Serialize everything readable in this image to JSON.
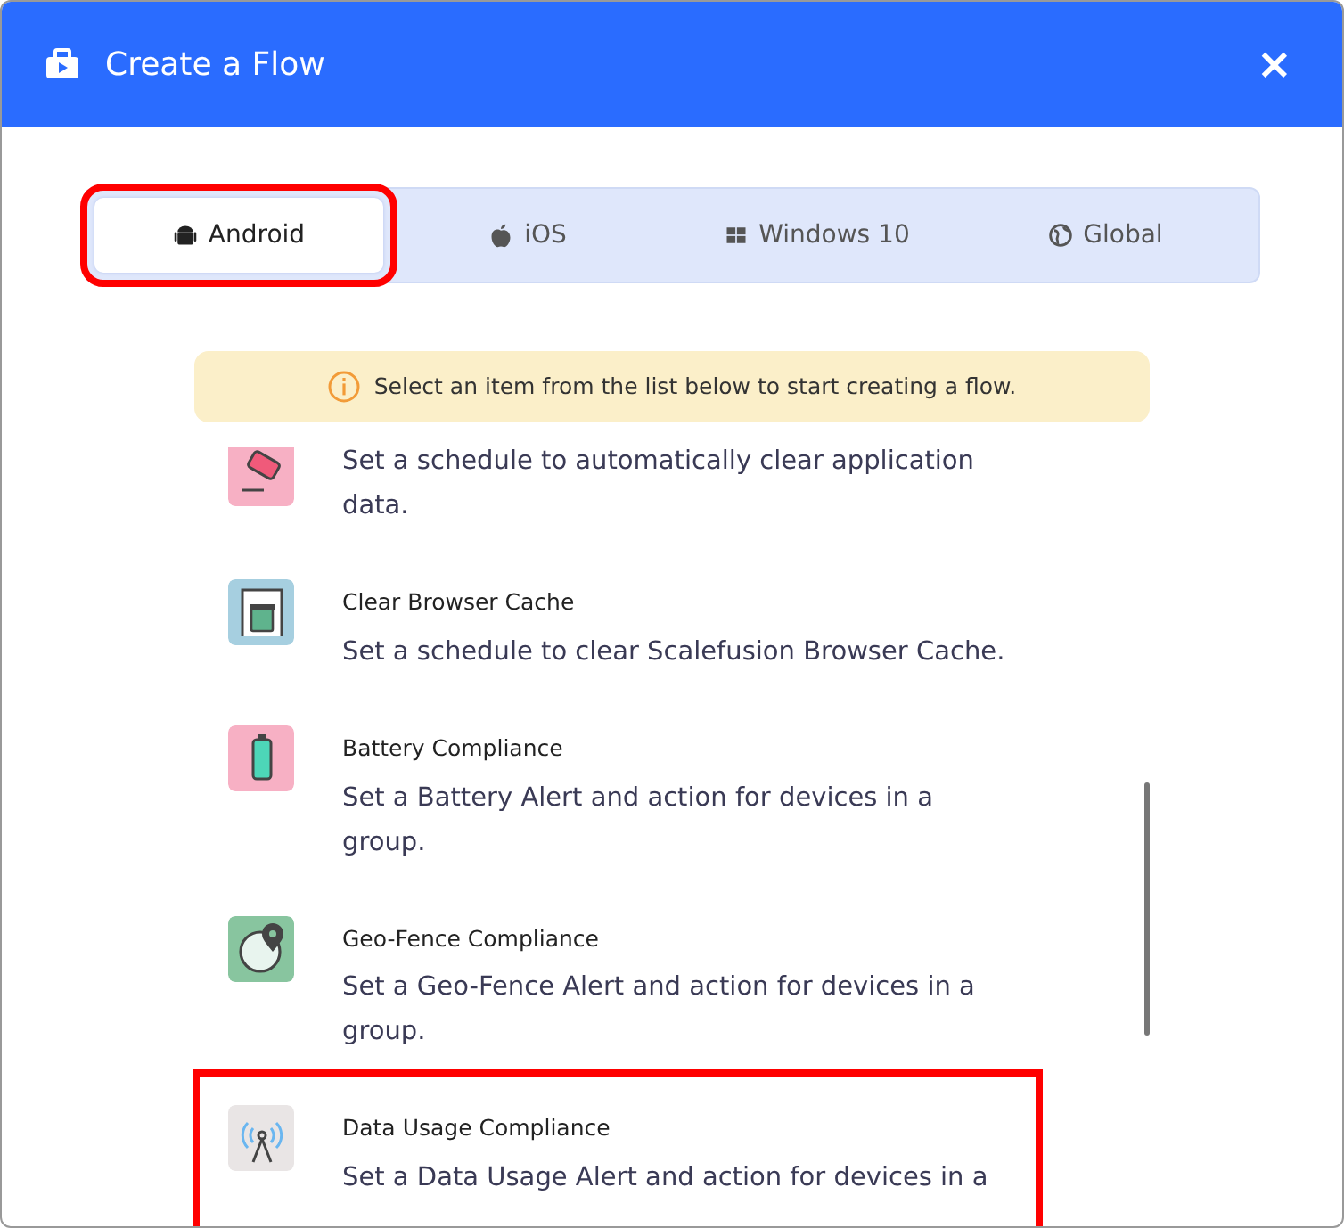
{
  "dialog": {
    "title": "Create a Flow",
    "close": "×"
  },
  "tabs": [
    {
      "label": "Android",
      "selected": true,
      "highlighted": true
    },
    {
      "label": "iOS",
      "selected": false,
      "highlighted": false
    },
    {
      "label": "Windows 10",
      "selected": false,
      "highlighted": false
    },
    {
      "label": "Global",
      "selected": false,
      "highlighted": false
    }
  ],
  "notice": "Select an item from the list below to start creating a flow.",
  "items": [
    {
      "kind": "eraser",
      "description": "Set a schedule to automatically clear application data.",
      "highlighted": false
    },
    {
      "kind": "cache",
      "title": "Clear Browser Cache",
      "description": "Set a schedule to clear Scalefusion Browser Cache.",
      "highlighted": false
    },
    {
      "kind": "battery",
      "title": "Battery Compliance",
      "description": "Set a Battery Alert and action for devices in a group.",
      "highlighted": false
    },
    {
      "kind": "geofence",
      "title": "Geo-Fence Compliance",
      "description": "Set a Geo-Fence Alert and action for devices in a group.",
      "highlighted": false
    },
    {
      "kind": "antenna",
      "title": "Data Usage Compliance",
      "description": "Set a Data Usage Alert and action for devices in a",
      "highlighted": true
    }
  ]
}
